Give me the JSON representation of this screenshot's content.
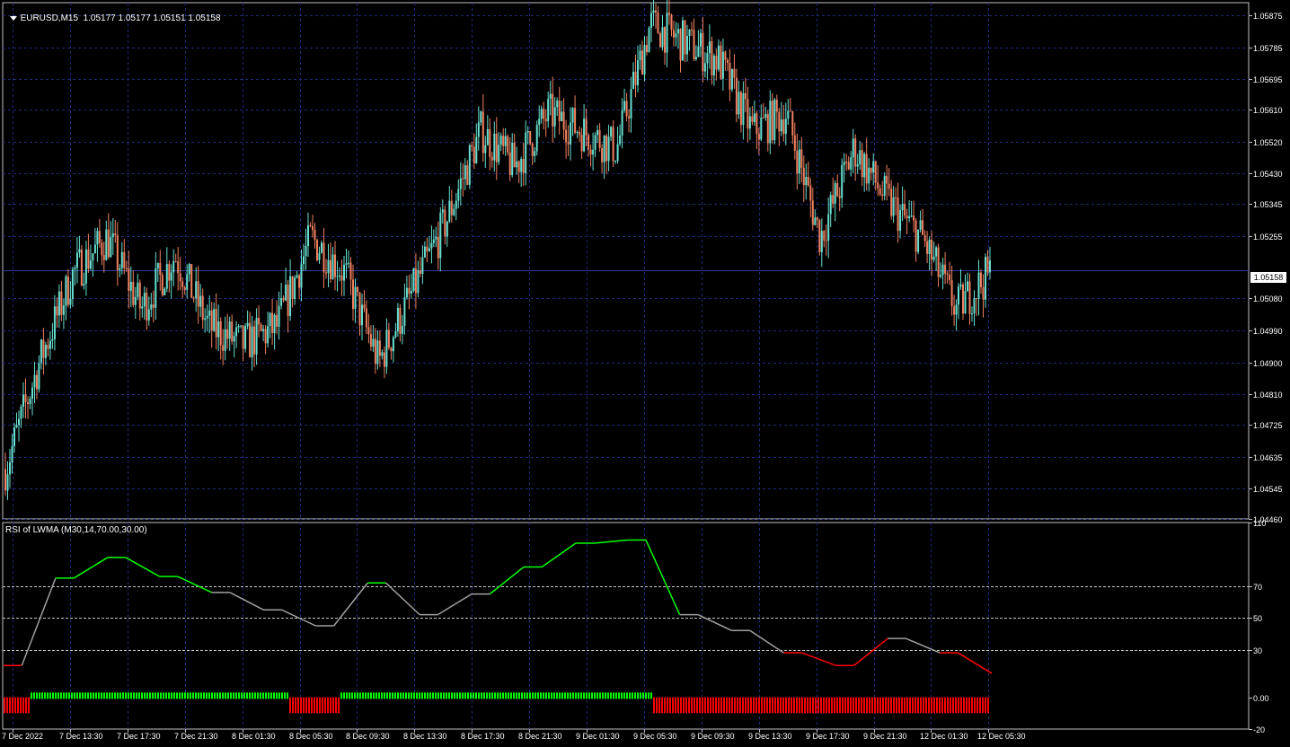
{
  "main_chart": {
    "symbol_header": "EURUSD,M15  1.05177 1.05177 1.05151 1.05158",
    "current_price": "1.05158",
    "price_levels": [
      "1.05875",
      "1.05785",
      "1.05695",
      "1.05610",
      "1.05520",
      "1.05430",
      "1.05345",
      "1.05255",
      "1.05080",
      "1.04990",
      "1.04900",
      "1.04810",
      "1.04725",
      "1.04635",
      "1.04545",
      "1.04460"
    ],
    "y_range": [
      1.0446,
      1.0591
    ]
  },
  "indicator": {
    "title": "RSI of LWMA (M30,14,70.00,30.00)",
    "levels": [
      "110",
      "70",
      "50",
      "30",
      "0.00",
      "-20"
    ],
    "y_range": [
      -20,
      110
    ],
    "colors": {
      "up": "#00ff00",
      "neutral": "#a0a0a0",
      "down": "#ff0000"
    }
  },
  "time_axis": [
    "7 Dec 2022",
    "7 Dec 13:30",
    "7 Dec 17:30",
    "7 Dec 21:30",
    "8 Dec 01:30",
    "8 Dec 05:30",
    "8 Dec 09:30",
    "8 Dec 13:30",
    "8 Dec 17:30",
    "8 Dec 21:30",
    "9 Dec 01:30",
    "9 Dec 05:30",
    "9 Dec 09:30",
    "9 Dec 13:30",
    "9 Dec 17:30",
    "9 Dec 21:30",
    "12 Dec 01:30",
    "12 Dec 05:30"
  ],
  "colors": {
    "bull": "#66e0d0",
    "bear": "#f08060",
    "grid": "#1f2a78",
    "bg": "#000000"
  },
  "chart_data": [
    {
      "type": "candlestick",
      "title": "EURUSD,M15",
      "x_labels": [
        "7 Dec 2022",
        "7 Dec 13:30",
        "7 Dec 17:30",
        "7 Dec 21:30",
        "8 Dec 01:30",
        "8 Dec 05:30",
        "8 Dec 09:30",
        "8 Dec 13:30",
        "8 Dec 17:30",
        "8 Dec 21:30",
        "9 Dec 01:30",
        "9 Dec 05:30",
        "9 Dec 09:30",
        "9 Dec 13:30",
        "9 Dec 17:30",
        "9 Dec 21:30",
        "12 Dec 01:30",
        "12 Dec 05:30"
      ],
      "series": [
        {
          "name": "close",
          "values": [
            1.046,
            1.049,
            1.0515,
            1.0525,
            1.0505,
            1.052,
            1.05,
            1.0495,
            1.05,
            1.0525,
            1.0515,
            1.049,
            1.051,
            1.053,
            1.0555,
            1.0545,
            1.056,
            1.0555,
            1.055,
            1.0585,
            1.058,
            1.0575,
            1.0555,
            1.056,
            1.0525,
            1.055,
            1.0535,
            1.0525,
            1.0505,
            1.0515
          ]
        }
      ],
      "ylim": [
        1.0446,
        1.0591
      ]
    },
    {
      "type": "line",
      "title": "RSI of LWMA (M30,14,70.00,30.00)",
      "series": [
        {
          "name": "RSI",
          "values": [
            20,
            75,
            88,
            76,
            66,
            55,
            45,
            72,
            52,
            65,
            82,
            97,
            99,
            52,
            42,
            28,
            20,
            37,
            28,
            15
          ]
        }
      ],
      "ylim": [
        -20,
        110
      ]
    }
  ]
}
